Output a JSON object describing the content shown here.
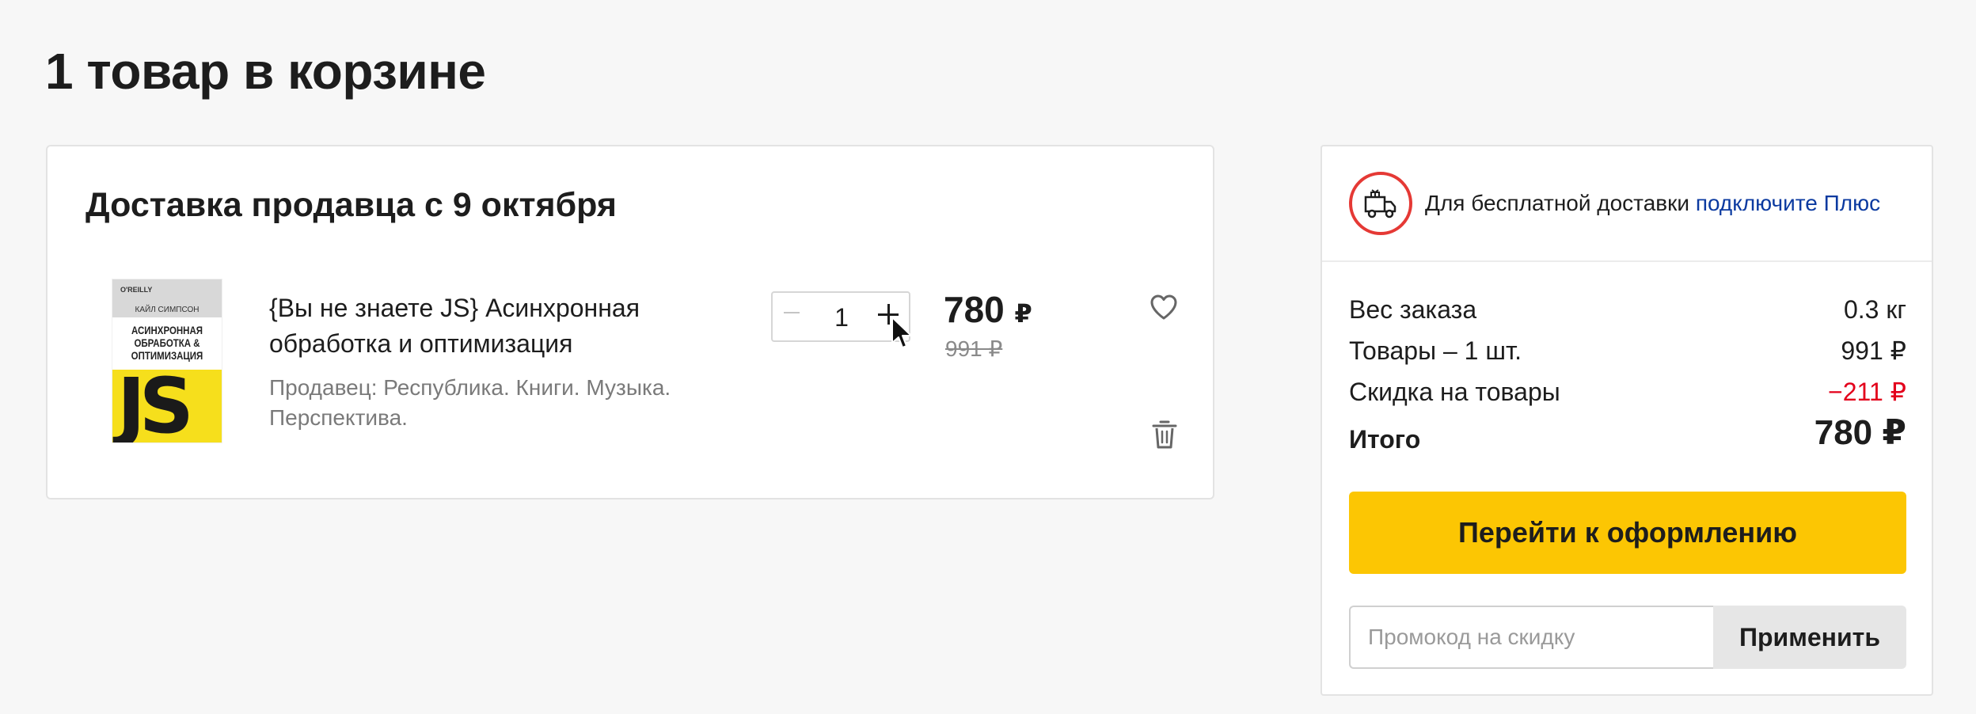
{
  "page_title": "1 товар в корзине",
  "delivery_group": {
    "title": "Доставка продавца с 9 октября",
    "item": {
      "cover": {
        "publisher": "O'REILLY",
        "author": "КАЙЛ СИМПСОН",
        "subtitle": "АСИНХРОННАЯ\nОБРАБОТКА &\nОПТИМИЗАЦИЯ",
        "logo": "JS"
      },
      "name": "{Вы не знаете JS} Асинхронная обработка и оптимизация",
      "seller": "Продавец: Республика. Книги. Музыка. Перспектива.",
      "quantity": "1",
      "price": "780",
      "currency": "₽",
      "old_price": "991 ₽"
    }
  },
  "summary": {
    "promo_prefix": "Для бесплатной доставки ",
    "promo_link": "подключите Плюс",
    "rows": [
      {
        "label": "Вес заказа",
        "value": "0.3 кг"
      },
      {
        "label": "Товары – 1 шт.",
        "value": "991 ₽"
      },
      {
        "label": "Скидка на товары",
        "value": "−211 ₽"
      },
      {
        "label": "Итого",
        "value": "780 ₽"
      }
    ],
    "checkout_label": "Перейти к оформлению",
    "promo_placeholder": "Промокод на скидку",
    "apply_label": "Применить"
  },
  "colors": {
    "accent_yellow": "#fcc603",
    "discount_red": "#e3001b",
    "link_blue": "#0b3aa0",
    "badge_red": "#e53935"
  }
}
